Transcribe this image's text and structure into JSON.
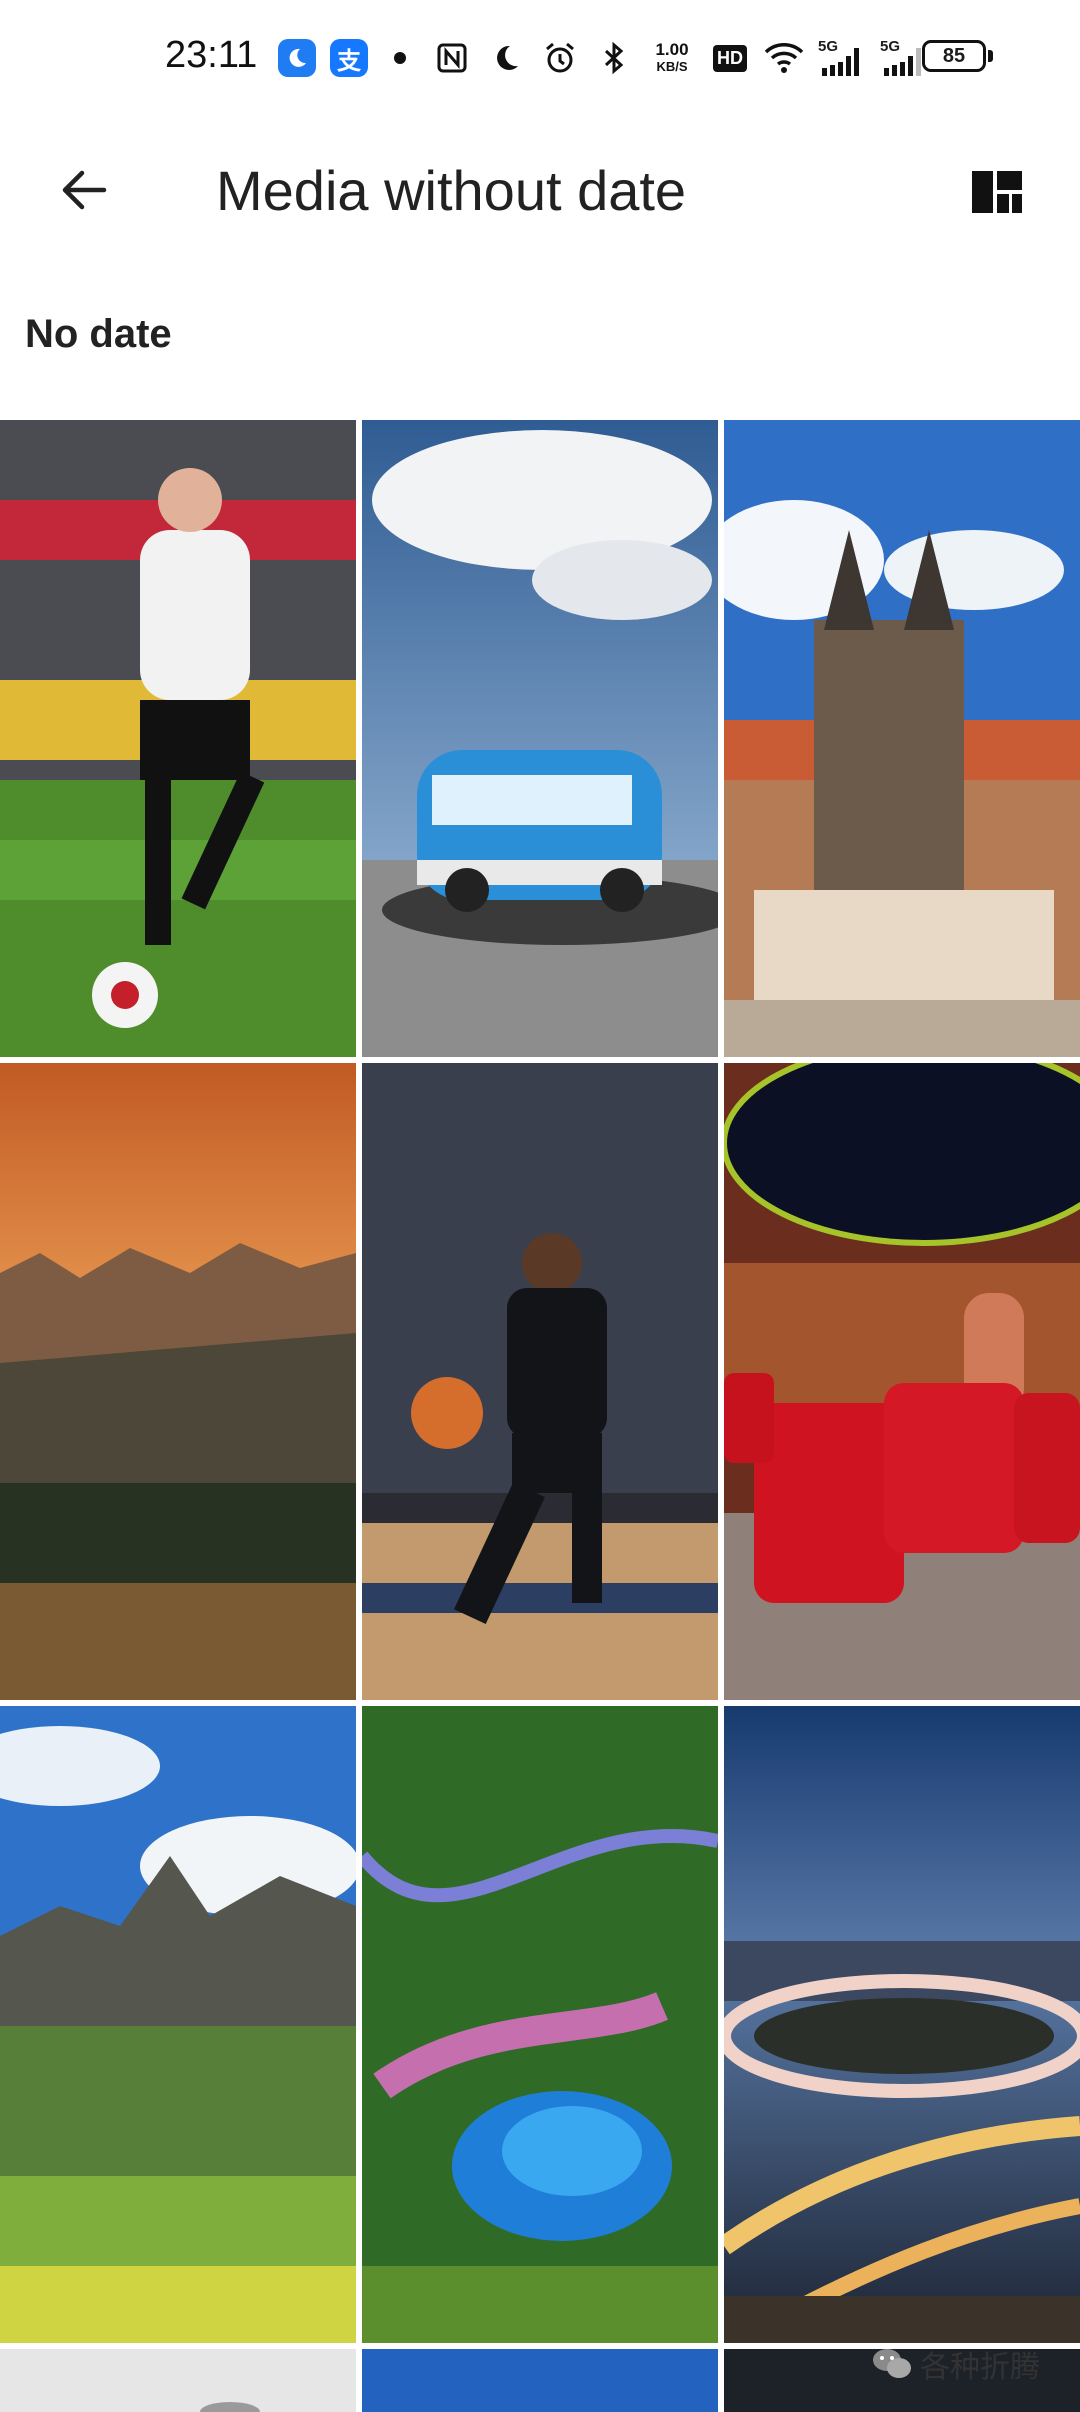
{
  "status_bar": {
    "time": "23:11",
    "app_badge_1_icon": "moon-app-icon",
    "app_badge_2_label": "支",
    "net_speed_value": "1.00",
    "net_speed_unit": "KB/S",
    "hd_label": "HD",
    "signal_1_label": "5G",
    "signal_2_label": "5G",
    "battery": "85"
  },
  "app_bar": {
    "title": "Media without date",
    "back_icon": "arrow-left-icon",
    "layout_icon": "grid-layout-icon"
  },
  "section": {
    "label": "No date"
  },
  "media": [
    {
      "subject": "soccer player"
    },
    {
      "subject": "blue van"
    },
    {
      "subject": "cathedral city"
    },
    {
      "subject": "sunset mountains"
    },
    {
      "subject": "basketball player"
    },
    {
      "subject": "home theater"
    },
    {
      "subject": "green valley mountains"
    },
    {
      "subject": "aerial lake road"
    },
    {
      "subject": "night highway interchange"
    }
  ],
  "watermark": {
    "text": "各种折腾"
  }
}
